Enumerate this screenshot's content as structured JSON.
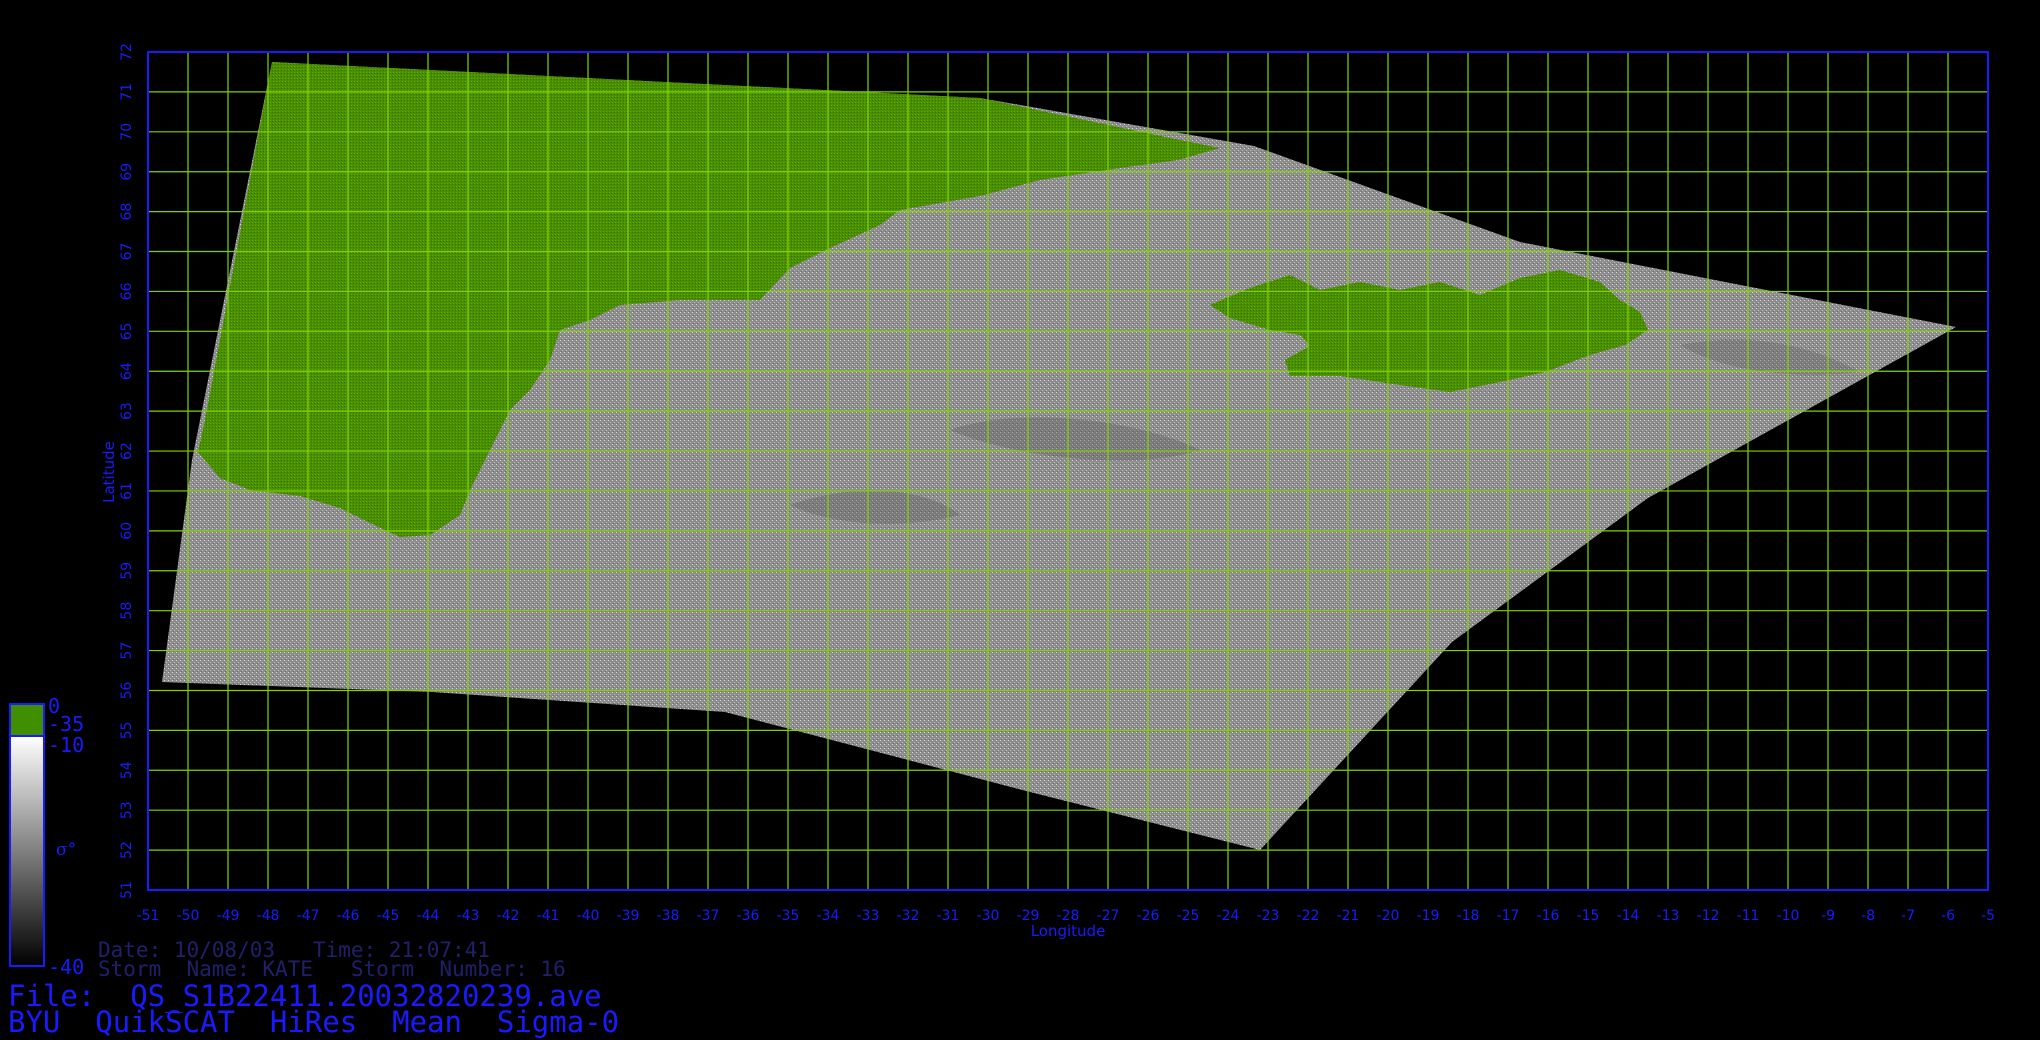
{
  "map": {
    "lon_range": [
      -51,
      -5
    ],
    "lat_range": [
      51,
      72
    ],
    "grid_color": "#7fd400",
    "frame_color": "#1a1aff",
    "land_color": "#4a8f00",
    "swath_color": "#8c8c8c",
    "xlabel": "Longitude",
    "ylabel": "Latitude",
    "x_ticks": [
      "-51",
      "-50",
      "-49",
      "-48",
      "-47",
      "-46",
      "-45",
      "-44",
      "-43",
      "-42",
      "-41",
      "-40",
      "-39",
      "-38",
      "-37",
      "-36",
      "-35",
      "-34",
      "-33",
      "-32",
      "-31",
      "-30",
      "-29",
      "-28",
      "-27",
      "-26",
      "-25",
      "-24",
      "-23",
      "-22",
      "-21",
      "-20",
      "-19",
      "-18",
      "-17",
      "-16",
      "-15",
      "-14",
      "-13",
      "-12",
      "-11",
      "-10",
      "-9",
      "-8",
      "-7",
      "-6",
      "-5"
    ],
    "y_ticks": [
      "51",
      "52",
      "53",
      "54",
      "55",
      "56",
      "57",
      "58",
      "59",
      "60",
      "61",
      "62",
      "63",
      "64",
      "65",
      "66",
      "67",
      "68",
      "69",
      "70",
      "71",
      "72"
    ]
  },
  "colorbar": {
    "land_top": "0",
    "land_bottom": "-35",
    "ocean_top": "-10",
    "ocean_bottom": "-40",
    "symbol": "σ°",
    "land_color": "#3f8f00",
    "ocean_gradient": [
      "#ffffff",
      "#000000"
    ]
  },
  "info": {
    "date_line": "Date: 10/08/03   Time: 21:07:41",
    "storm_line": "Storm  Name: KATE   Storm  Number: 16",
    "file_line": "File:  QS_S1B22411.20032820239.ave",
    "product_line": "BYU  QuikSCAT  HiRes  Mean  Sigma-0"
  }
}
